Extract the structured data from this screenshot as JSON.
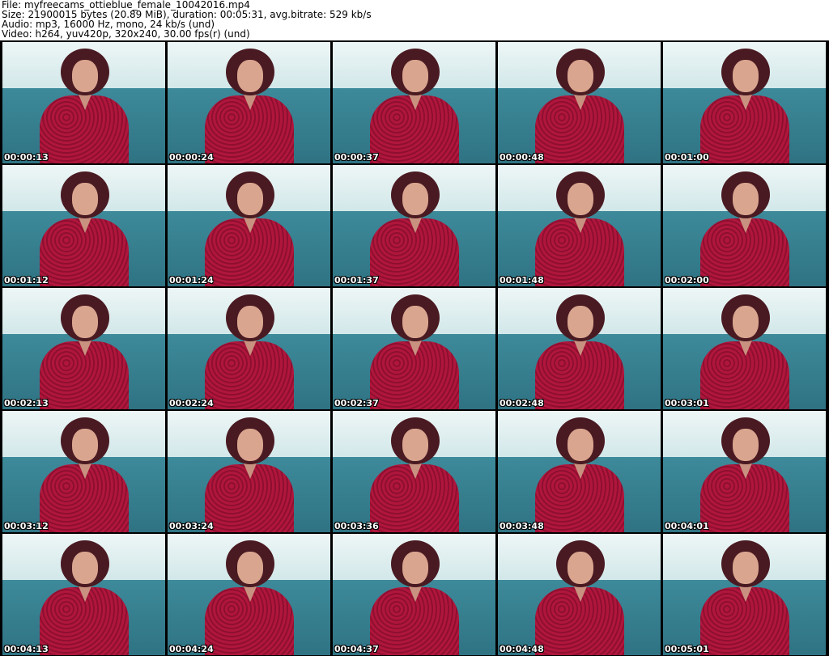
{
  "header": {
    "file": "File: myfreecams_ottieblue_female_10042016.mp4",
    "size": "Size: 21900015 bytes (20.89 MiB), duration: 00:05:31, avg.bitrate: 529 kb/s",
    "audio": "Audio: mp3, 16000 Hz, mono, 24 kb/s (und)",
    "video": "Video: h264, yuv420p, 320x240, 30.00 fps(r) (und)"
  },
  "thumbnails": [
    "00:00:13",
    "00:00:24",
    "00:00:37",
    "00:00:48",
    "00:01:00",
    "00:01:12",
    "00:01:24",
    "00:01:37",
    "00:01:48",
    "00:02:00",
    "00:02:13",
    "00:02:24",
    "00:02:37",
    "00:02:48",
    "00:03:01",
    "00:03:12",
    "00:03:24",
    "00:03:36",
    "00:03:48",
    "00:04:01",
    "00:04:13",
    "00:04:24",
    "00:04:37",
    "00:04:48",
    "00:05:01"
  ]
}
